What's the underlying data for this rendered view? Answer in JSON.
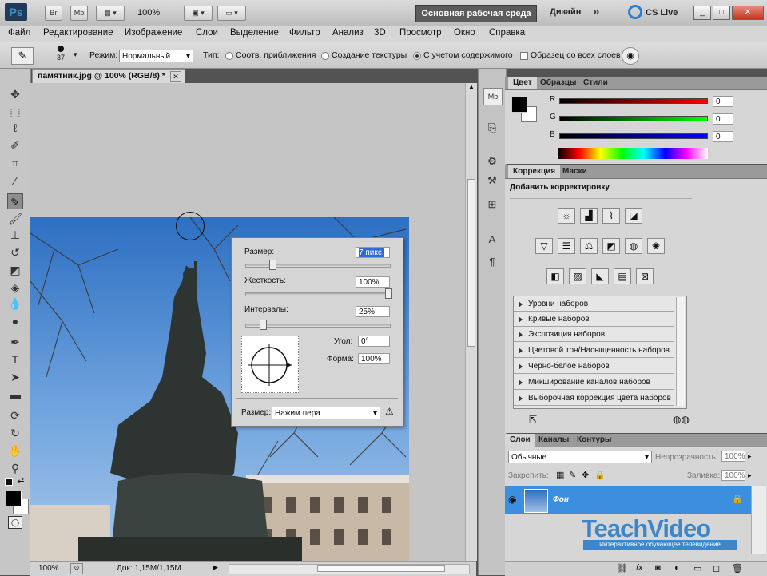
{
  "app": {
    "logo": "Ps",
    "buttons": [
      "Br",
      "Mb"
    ],
    "zoom": "100%",
    "workspace_active": "Основная рабочая среда",
    "workspace_design": "Дизайн",
    "more": "»",
    "cs_live": "CS Live",
    "window_controls": [
      "_",
      "□",
      "✕"
    ]
  },
  "menu": [
    "Файл",
    "Редактирование",
    "Изображение",
    "Слои",
    "Выделение",
    "Фильтр",
    "Анализ",
    "3D",
    "Просмотр",
    "Окно",
    "Справка"
  ],
  "options": {
    "brush_size": "37",
    "mode_label": "Режим:",
    "mode_value": "Нормальный",
    "type_label": "Тип:",
    "radio1": "Соотв. приближения",
    "radio2": "Создание текстуры",
    "radio3": "С учетом содержимого",
    "sample_all": "Образец со всех слоев"
  },
  "document": {
    "tab_title": "памятник.jpg @ 100% (RGB/8) *",
    "status_zoom": "100%",
    "status_doc": "Док: 1,15M/1,15M"
  },
  "brush_popup": {
    "size_label": "Размер:",
    "size_value": "7 пикс.",
    "hardness_label": "Жесткость:",
    "hardness_value": "100%",
    "spacing_label": "Интервалы:",
    "spacing_value": "25%",
    "angle_label": "Угол:",
    "angle_value": "0°",
    "roundness_label": "Форма:",
    "roundness_value": "100%",
    "pen_label": "Размер:",
    "pen_value": "Нажим пера"
  },
  "color_panel": {
    "tabs": [
      "Цвет",
      "Образцы",
      "Стили"
    ],
    "channels": [
      {
        "label": "R",
        "value": "0",
        "color": "#d01010"
      },
      {
        "label": "G",
        "value": "0",
        "color": "#10b010"
      },
      {
        "label": "B",
        "value": "0",
        "color": "#1020d0"
      }
    ]
  },
  "adjust_panel": {
    "tabs": [
      "Коррекция",
      "Маски"
    ],
    "heading": "Добавить корректировку",
    "presets": [
      "Уровни наборов",
      "Кривые наборов",
      "Экспозиция наборов",
      "Цветовой тон/Насыщенность наборов",
      "Черно-белое наборов",
      "Микширование каналов наборов",
      "Выборочная коррекция цвета наборов"
    ]
  },
  "layers_panel": {
    "tabs": [
      "Слои",
      "Каналы",
      "Контуры"
    ],
    "blend_mode": "Обычные",
    "opacity_label": "Непрозрачность:",
    "opacity_value": "100%",
    "lock_label": "Закрепить:",
    "fill_label": "Заливка:",
    "fill_value": "100%",
    "layer_name": "Фон"
  },
  "watermark": {
    "brand": "TeachVideo",
    "tagline": "Интерактивное обучающее телевидение"
  }
}
